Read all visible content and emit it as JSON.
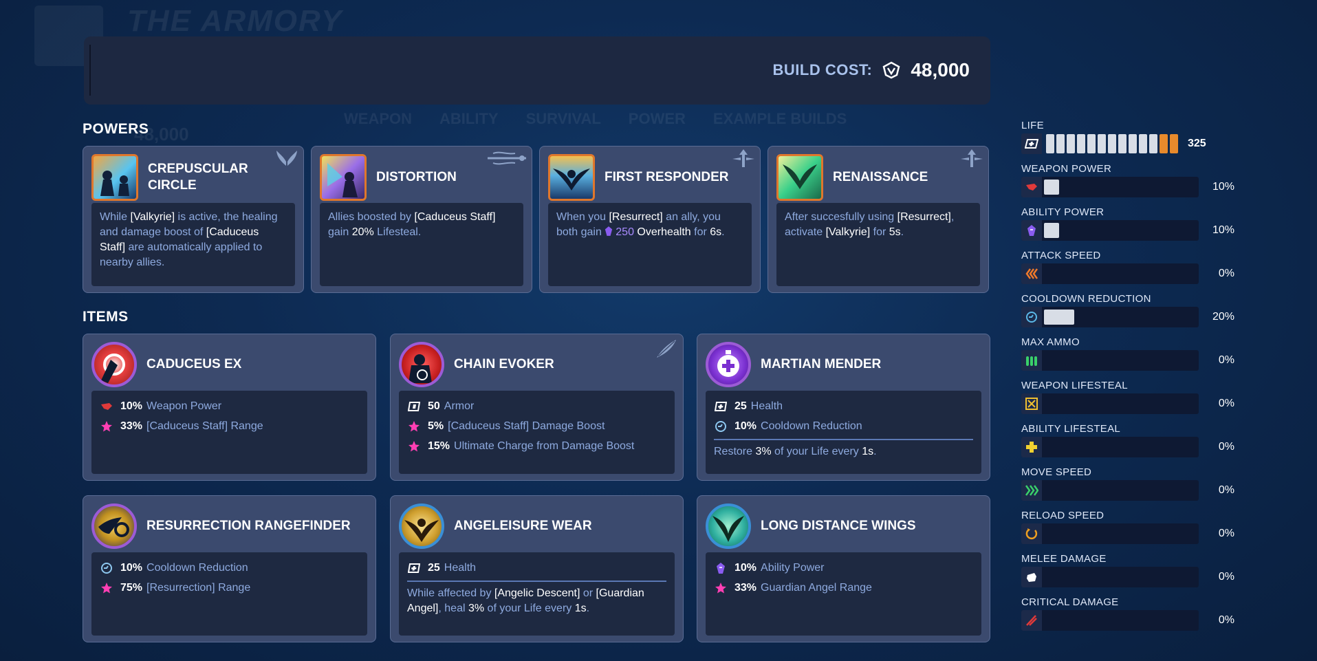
{
  "background": {
    "title": "THE ARMORY",
    "tabs": [
      "WEAPON",
      "ABILITY",
      "SURVIVAL",
      "POWER",
      "EXAMPLE BUILDS"
    ],
    "cost": "48,000"
  },
  "build_cost": {
    "label": "BUILD COST:",
    "value": "48,000",
    "icon": "currency-icon"
  },
  "powers": {
    "title": "POWERS",
    "cards": [
      {
        "name": "CREPUSCULAR CIRCLE",
        "emblem": "wings-icon",
        "desc": [
          [
            "t",
            "While "
          ],
          [
            "h",
            "[Valkyrie]"
          ],
          [
            "t",
            " is active, the healing and damage boost of "
          ],
          [
            "h",
            "[Caduceus Staff]"
          ],
          [
            "t",
            " are automatically applied to nearby allies."
          ]
        ]
      },
      {
        "name": "DISTORTION",
        "emblem": "staff-icon",
        "desc": [
          [
            "t",
            "Allies boosted by "
          ],
          [
            "h",
            "[Caduceus Staff]"
          ],
          [
            "t",
            " gain "
          ],
          [
            "h",
            "20%"
          ],
          [
            "t",
            " Lifesteal."
          ]
        ]
      },
      {
        "name": "FIRST RESPONDER",
        "emblem": "resurrect-icon",
        "desc": [
          [
            "t",
            "When you "
          ],
          [
            "h",
            "[Resurrect]"
          ],
          [
            "t",
            " an ally, you both gain "
          ],
          [
            "p",
            "250"
          ],
          [
            "h",
            " Overhealth"
          ],
          [
            "t",
            " for "
          ],
          [
            "h",
            "6s"
          ],
          [
            "t",
            "."
          ]
        ]
      },
      {
        "name": "RENAISSANCE",
        "emblem": "resurrect-icon",
        "desc": [
          [
            "t",
            "After succesfully using "
          ],
          [
            "h",
            "[Resurrect]"
          ],
          [
            "t",
            ", activate "
          ],
          [
            "h",
            "[Valkyrie]"
          ],
          [
            "t",
            " for "
          ],
          [
            "h",
            "5s"
          ],
          [
            "t",
            "."
          ]
        ]
      }
    ]
  },
  "items": {
    "title": "ITEMS",
    "cards": [
      {
        "name": "CADUCEUS EX",
        "ring": "#9c5bd6",
        "stats": [
          {
            "icon": "weapon-power-icon",
            "value": "10%",
            "label": "Weapon Power"
          },
          {
            "icon": "star-icon",
            "value": "33%",
            "label": "[Caduceus Staff] Range"
          }
        ]
      },
      {
        "name": "CHAIN EVOKER",
        "ring": "#9c5bd6",
        "emblem": "feather-icon",
        "stats": [
          {
            "icon": "armor-icon",
            "value": "50",
            "label": "Armor"
          },
          {
            "icon": "star-icon",
            "value": "5%",
            "label": "[Caduceus Staff] Damage Boost"
          },
          {
            "icon": "star-icon",
            "value": "15%",
            "label": "Ultimate Charge from Damage Boost"
          }
        ]
      },
      {
        "name": "MARTIAN MENDER",
        "ring": "#9c5bd6",
        "stats": [
          {
            "icon": "health-icon",
            "value": "25",
            "label": "Health"
          },
          {
            "icon": "cooldown-icon",
            "value": "10%",
            "label": "Cooldown Reduction"
          }
        ],
        "note": {
          "pre": "Restore ",
          "v1": "3%",
          "mid": " of your Life every ",
          "v2": "1s",
          "post": "."
        }
      },
      {
        "name": "RESURRECTION RANGEFINDER",
        "ring": "#9c5bd6",
        "stats": [
          {
            "icon": "cooldown-icon",
            "value": "10%",
            "label": "Cooldown Reduction"
          },
          {
            "icon": "star-icon",
            "value": "75%",
            "label": "[Resurrection] Range"
          }
        ]
      },
      {
        "name": "ANGELEISURE WEAR",
        "ring": "#3a8fd6",
        "stats": [
          {
            "icon": "health-icon",
            "value": "25",
            "label": "Health"
          }
        ],
        "note2": {
          "pre": "While affected by ",
          "h1": "[Angelic Descent]",
          "or": " or ",
          "h2": "[Guardian Angel]",
          "mid": ", heal ",
          "v1": "3%",
          "mid2": " of your Life every ",
          "v2": "1s",
          "post": "."
        }
      },
      {
        "name": "LONG DISTANCE WINGS",
        "ring": "#3a8fd6",
        "stats": [
          {
            "icon": "ability-power-icon",
            "value": "10%",
            "label": "Ability Power"
          },
          {
            "icon": "star-icon",
            "value": "33%",
            "label": "Guardian Angel Range"
          }
        ]
      }
    ]
  },
  "stats": {
    "life": {
      "label": "LIFE",
      "value": "325",
      "health_segments": 11,
      "armor_segments": 2
    },
    "rows": [
      {
        "label": "WEAPON POWER",
        "value": "10%",
        "fill": 0.1,
        "icon": "weapon-power-icon",
        "color": "#e03a3a"
      },
      {
        "label": "ABILITY POWER",
        "value": "10%",
        "fill": 0.1,
        "icon": "ability-power-icon",
        "color": "#8a5cf0"
      },
      {
        "label": "ATTACK SPEED",
        "value": "0%",
        "fill": 0,
        "icon": "attack-speed-icon",
        "color": "#f07a2a"
      },
      {
        "label": "COOLDOWN REDUCTION",
        "value": "20%",
        "fill": 0.2,
        "icon": "cooldown-icon",
        "color": "#5ab8e8"
      },
      {
        "label": "MAX AMMO",
        "value": "0%",
        "fill": 0,
        "icon": "ammo-icon",
        "color": "#3ad06a"
      },
      {
        "label": "WEAPON LIFESTEAL",
        "value": "0%",
        "fill": 0,
        "icon": "weapon-lifesteal-icon",
        "color": "#f0c030"
      },
      {
        "label": "ABILITY LIFESTEAL",
        "value": "0%",
        "fill": 0,
        "icon": "ability-lifesteal-icon",
        "color": "#f0d030"
      },
      {
        "label": "MOVE SPEED",
        "value": "0%",
        "fill": 0,
        "icon": "move-speed-icon",
        "color": "#3ad06a"
      },
      {
        "label": "RELOAD SPEED",
        "value": "0%",
        "fill": 0,
        "icon": "reload-speed-icon",
        "color": "#f0a020"
      },
      {
        "label": "MELEE DAMAGE",
        "value": "0%",
        "fill": 0,
        "icon": "melee-icon",
        "color": "#ffffff"
      },
      {
        "label": "CRITICAL DAMAGE",
        "value": "0%",
        "fill": 0,
        "icon": "critical-icon",
        "color": "#e03a3a"
      }
    ]
  }
}
